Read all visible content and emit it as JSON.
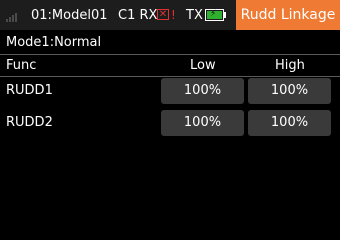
{
  "status_bar": {
    "signal_icon": "signal-strength-icon",
    "model": "01:Model01",
    "receiver_label": "C1 RX",
    "rx_status_icon": "rx-disconnected-icon",
    "rx_warning": "!",
    "tx_label": "TX",
    "tx_battery_icon": "battery-charging-icon",
    "title": "Rudd Linkage",
    "colors": {
      "title_bg": "#ef7a33",
      "battery_fill": "#2fb12f",
      "alert": "#e03030"
    }
  },
  "mode": "Mode1:Normal",
  "table": {
    "headers": [
      "Func",
      "Low",
      "High"
    ],
    "rows": [
      {
        "func": "RUDD1",
        "low": "100%",
        "high": "100%"
      },
      {
        "func": "RUDD2",
        "low": "100%",
        "high": "100%"
      }
    ]
  }
}
